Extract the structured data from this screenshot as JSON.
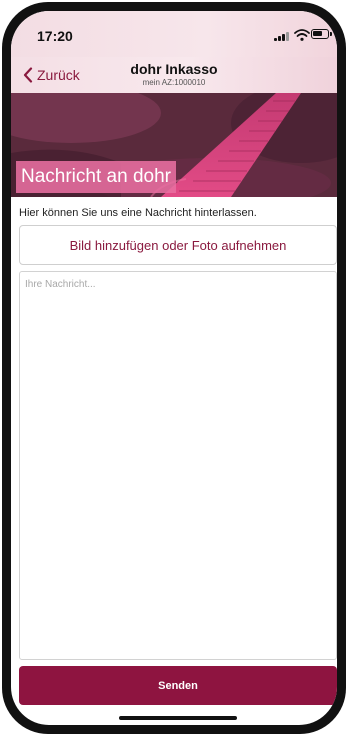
{
  "status_bar": {
    "time": "17:20"
  },
  "nav": {
    "back_label": "Zurück",
    "title": "dohr Inkasso",
    "subtitle": "mein AZ:1000010"
  },
  "hero": {
    "title": "Nachricht an dohr"
  },
  "content": {
    "hint": "Hier können Sie uns eine Nachricht hinterlassen.",
    "photo_button": "Bild hinzufügen oder Foto aufnehmen",
    "message_placeholder": "Ihre Nachricht...",
    "message_value": "",
    "send_button": "Senden"
  },
  "colors": {
    "accent": "#8e1440",
    "hero_label_bg": "#e86ea0",
    "nav_bg": "#f4dfe5"
  },
  "icons": {
    "back": "chevron-left-icon",
    "signal": "cellular-signal-icon",
    "wifi": "wifi-icon",
    "battery": "battery-icon"
  }
}
